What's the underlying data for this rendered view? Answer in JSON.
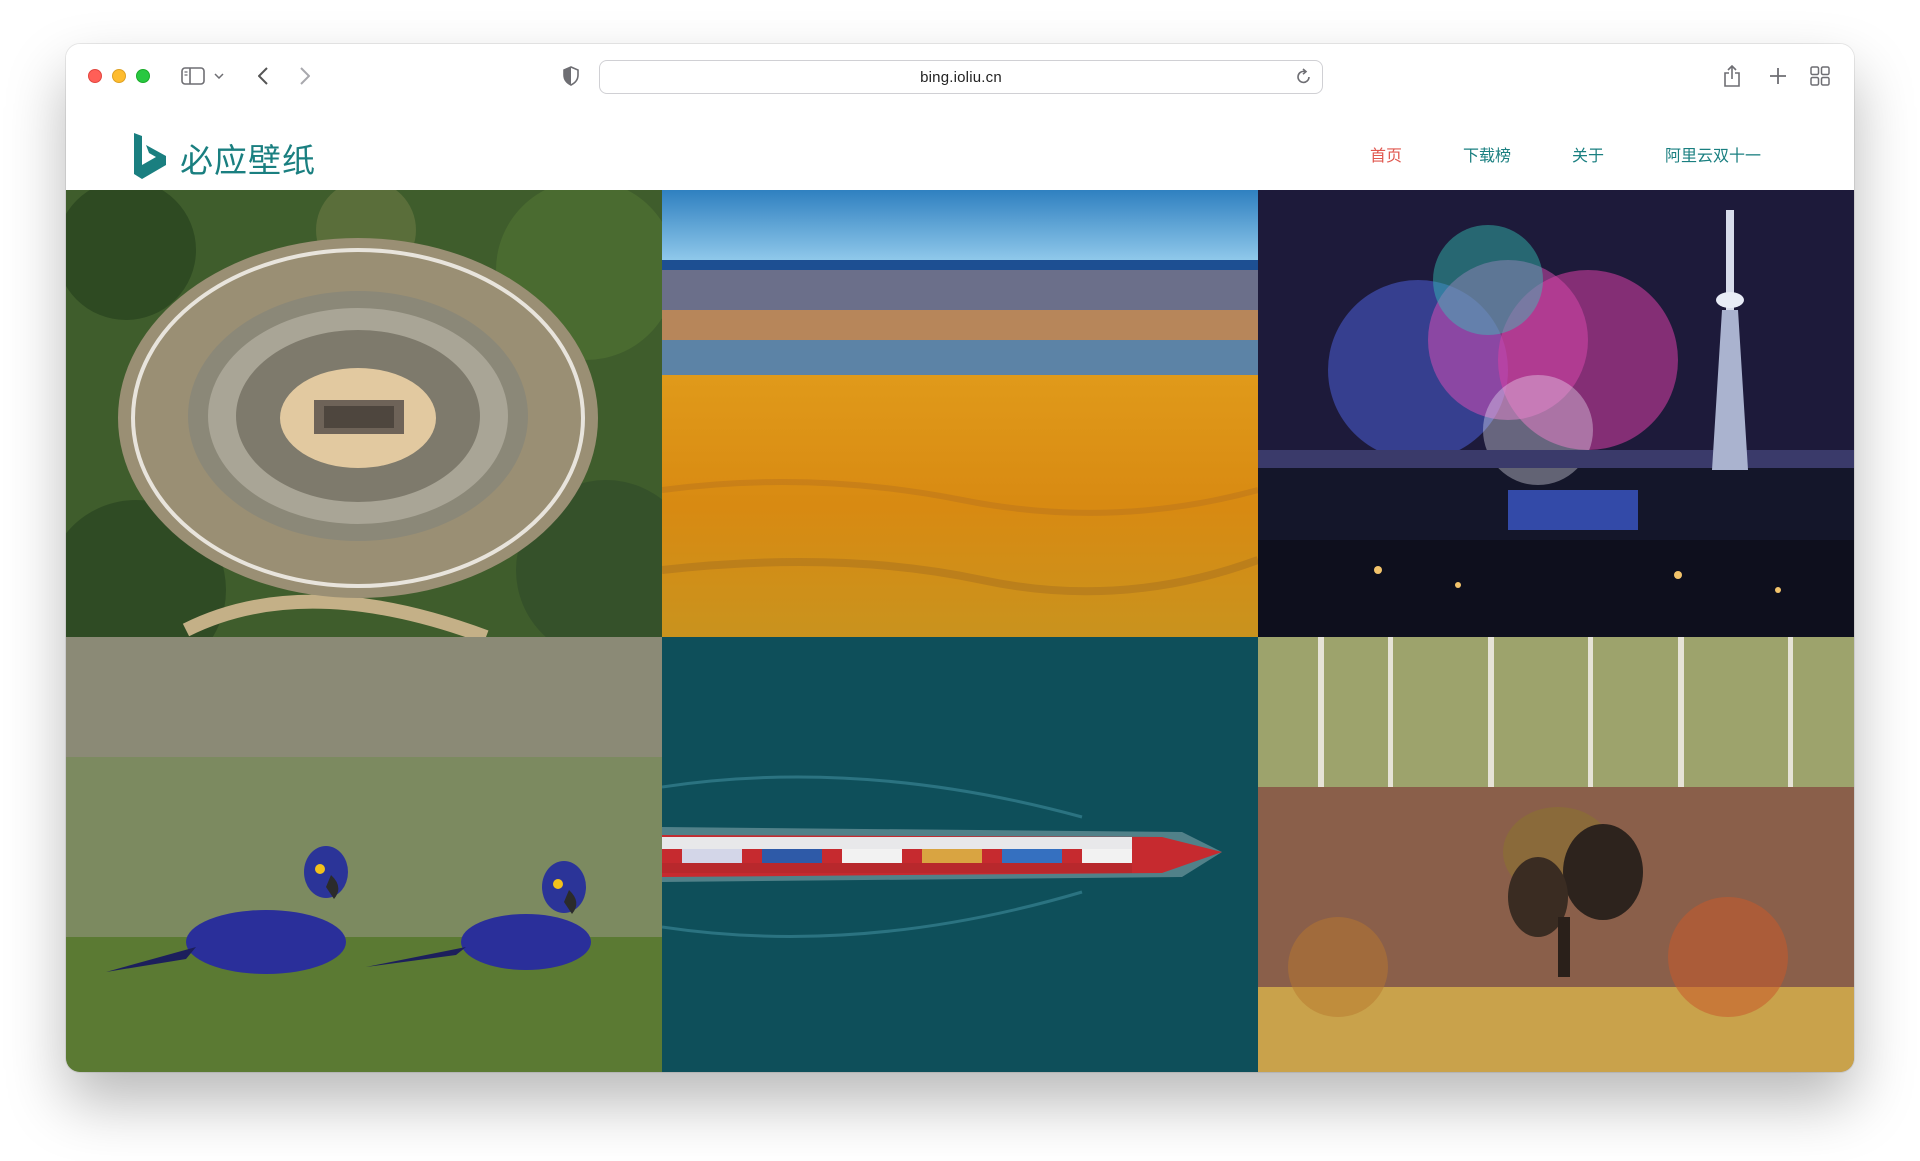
{
  "browser": {
    "url": "bing.ioliu.cn",
    "icons": [
      "sidebar-icon",
      "chevron-down-icon",
      "back-icon",
      "forward-icon",
      "privacy-shield-icon",
      "reload-icon",
      "share-icon",
      "new-tab-icon",
      "tab-overview-icon"
    ]
  },
  "site": {
    "logo_text": "必应壁纸",
    "brand_color": "#1a7f80",
    "active_color": "#e0584f",
    "nav": [
      {
        "label": "首页",
        "active": true
      },
      {
        "label": "下载榜",
        "active": false
      },
      {
        "label": "关于",
        "active": false
      },
      {
        "label": "阿里云双十一",
        "active": false
      }
    ]
  },
  "gallery": {
    "images": [
      {
        "subject": "aerial-roman-amphitheatre"
      },
      {
        "subject": "desert-meets-ocean"
      },
      {
        "subject": "fireworks-macau-tower"
      },
      {
        "subject": "hyacinth-macaws-grass"
      },
      {
        "subject": "container-ship-aerial"
      },
      {
        "subject": "bison-autumn-forest"
      }
    ]
  }
}
